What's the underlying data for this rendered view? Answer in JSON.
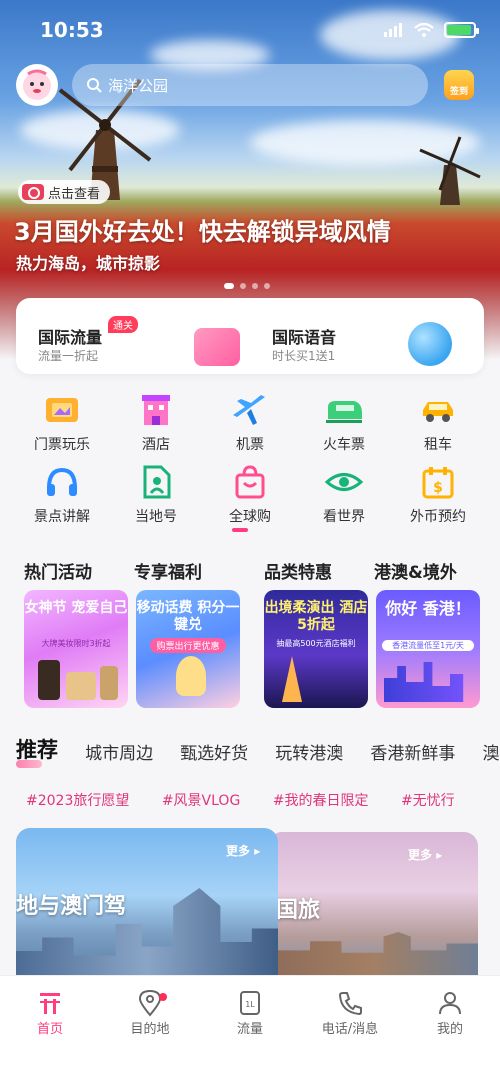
{
  "status_bar": {
    "time": "10:53"
  },
  "search": {
    "placeholder": "海洋公园"
  },
  "signin": {
    "label": "签到"
  },
  "hero": {
    "view_label": "点击查看",
    "title": "3月国外好去处！快去解锁异域风情",
    "subtitle": "热力海岛，城市掠影"
  },
  "services_card": {
    "items": [
      {
        "title": "国际流量",
        "badge": "通关",
        "subtitle": "流量一折起"
      },
      {
        "title": "国际语音",
        "subtitle": "时长买1送1"
      }
    ]
  },
  "icon_grid": {
    "items": [
      {
        "label": "门票玩乐",
        "icon": "ticket-icon"
      },
      {
        "label": "酒店",
        "icon": "hotel-icon"
      },
      {
        "label": "机票",
        "icon": "airplane-icon"
      },
      {
        "label": "火车票",
        "icon": "train-icon"
      },
      {
        "label": "租车",
        "icon": "car-icon"
      },
      {
        "label": "景点讲解",
        "icon": "headphones-icon"
      },
      {
        "label": "当地号",
        "icon": "sim-card-icon"
      },
      {
        "label": "全球购",
        "icon": "shopping-bag-icon"
      },
      {
        "label": "看世界",
        "icon": "eye-icon"
      },
      {
        "label": "外币预约",
        "icon": "currency-icon"
      }
    ]
  },
  "promo": {
    "sections": [
      {
        "header": "热门活动",
        "tile_text": "女神节 宠爱自己",
        "tile_sub": "大牌美妆限时3折起"
      },
      {
        "header": "专享福利",
        "tile_text": "移动话费 积分一键兑",
        "tile_sub": "购票出行更优惠"
      },
      {
        "header": "品类特惠",
        "tile_text": "出境柔演出 酒店5折起",
        "tile_sub": "抽最高500元酒店福利"
      },
      {
        "header": "港澳&境外",
        "tile_text": "你好 香港！",
        "tile_sub": "香港流量低至1元/天"
      }
    ]
  },
  "tabs": [
    "推荐",
    "城市周边",
    "甄选好货",
    "玩转港澳",
    "香港新鲜事",
    "澳"
  ],
  "hashtags": [
    "#2023旅行愿望",
    "#风景VLOG",
    "#我的春日限定",
    "#无忧行"
  ],
  "feed": [
    {
      "title": "地与澳门驾",
      "more": "更多"
    },
    {
      "title": "国旅",
      "more": "更多"
    }
  ],
  "bottom_nav": [
    {
      "label": "首页",
      "icon": "home-icon"
    },
    {
      "label": "目的地",
      "icon": "location-pin-icon"
    },
    {
      "label": "流量",
      "icon": "sim-card-icon"
    },
    {
      "label": "电话/消息",
      "icon": "phone-icon"
    },
    {
      "label": "我的",
      "icon": "person-icon"
    }
  ],
  "colors": {
    "accent": "#ff3d7f",
    "hashtag": "#e0357a",
    "badge": "#ff3d5b"
  }
}
